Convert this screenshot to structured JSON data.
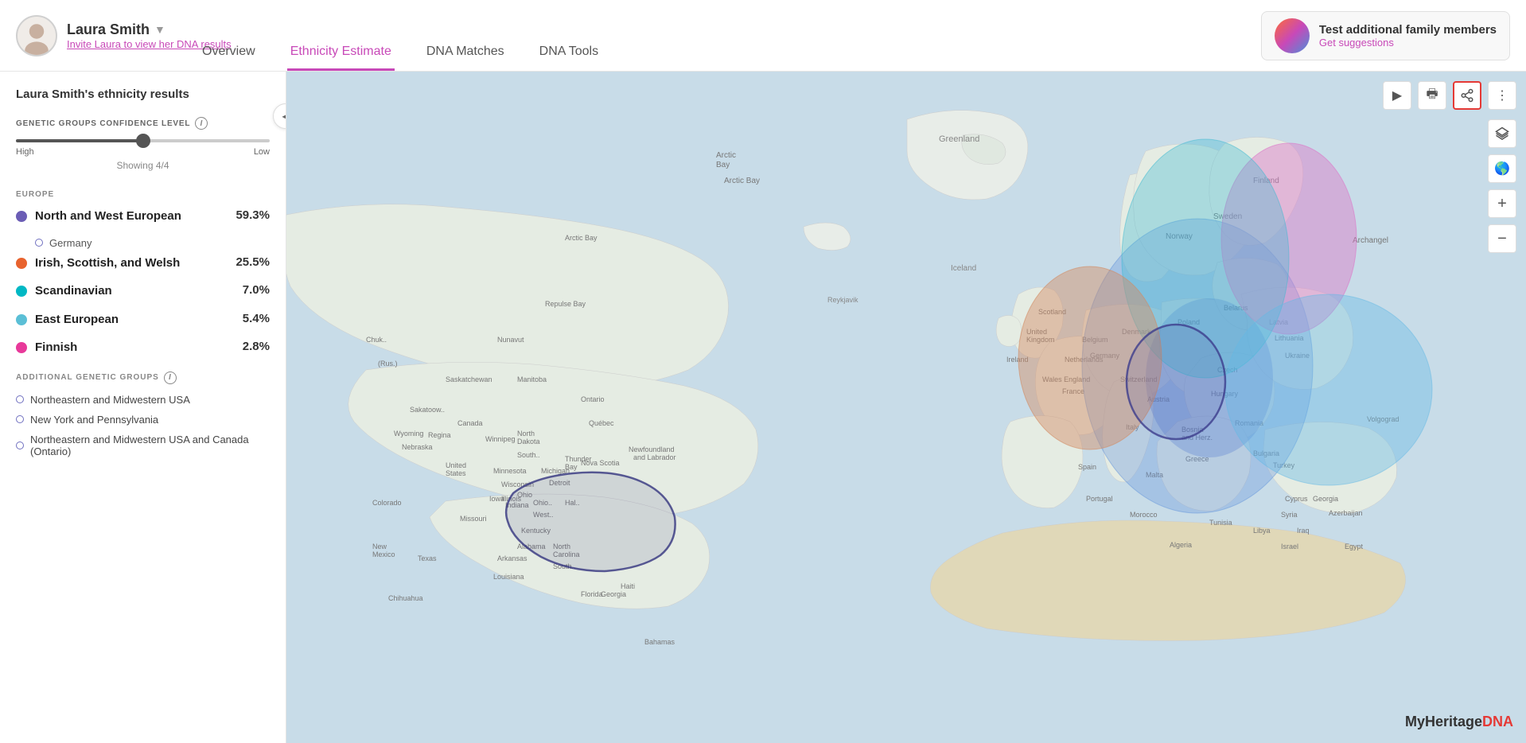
{
  "header": {
    "user_name": "Laura Smith",
    "caret": "▼",
    "invite_text": "Invite Laura to view her DNA results",
    "tabs": [
      {
        "id": "overview",
        "label": "Overview",
        "active": false
      },
      {
        "id": "ethnicity",
        "label": "Ethnicity Estimate",
        "active": true
      },
      {
        "id": "dna-matches",
        "label": "DNA Matches",
        "active": false
      },
      {
        "id": "dna-tools",
        "label": "DNA Tools",
        "active": false
      }
    ],
    "banner": {
      "title": "Test additional family members",
      "link": "Get suggestions"
    }
  },
  "sidebar": {
    "title": "Laura Smith's ethnicity results",
    "collapse_btn": "◀",
    "confidence": {
      "label": "GENETIC GROUPS CONFIDENCE LEVEL",
      "high": "High",
      "low": "Low",
      "showing": "Showing 4/4"
    },
    "europe_label": "EUROPE",
    "ethnicities": [
      {
        "id": "nw-european",
        "color": "#6b5db5",
        "name": "North and West European",
        "pct": "59.3%",
        "sub": {
          "name": "Germany",
          "color": "#8080cc"
        }
      },
      {
        "id": "irish",
        "color": "#e8632e",
        "name": "Irish, Scottish, and Welsh",
        "pct": "25.5%",
        "sub": null
      },
      {
        "id": "scandinavian",
        "color": "#00b8c4",
        "name": "Scandinavian",
        "pct": "7.0%",
        "sub": null
      },
      {
        "id": "east-european",
        "color": "#5bbfd6",
        "name": "East European",
        "pct": "5.4%",
        "sub": null
      },
      {
        "id": "finnish",
        "color": "#e8399a",
        "name": "Finnish",
        "pct": "2.8%",
        "sub": null
      }
    ],
    "additional_label": "ADDITIONAL GENETIC GROUPS",
    "additional": [
      {
        "id": "ne-midwestern",
        "name": "Northeastern and Midwestern USA"
      },
      {
        "id": "ny-pa",
        "name": "New York and Pennsylvania"
      },
      {
        "id": "ne-midwestern-canada",
        "name": "Northeastern and Midwestern USA and Canada (Ontario)"
      }
    ]
  },
  "map": {
    "zoom_in": "+",
    "zoom_out": "−",
    "logo_my": "My",
    "logo_heritage": "Heritage",
    "logo_dna": "DNA"
  }
}
